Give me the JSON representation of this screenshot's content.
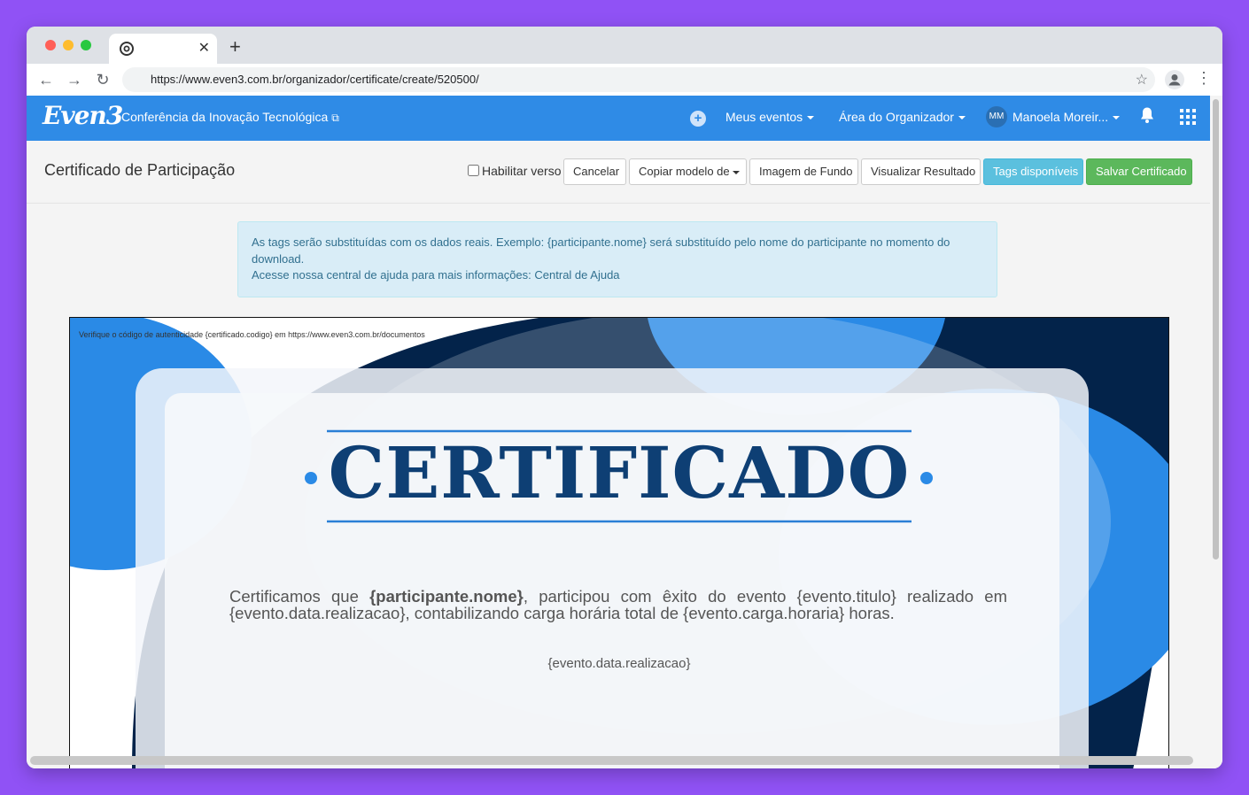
{
  "browser": {
    "url": "https://www.even3.com.br/organizador/certificate/create/520500/"
  },
  "navbar": {
    "logo": "Even3",
    "event_title": "Conferência da Inovação Tecnológica",
    "my_events": "Meus eventos",
    "organizer_area": "Área do Organizador",
    "user_initials": "MM",
    "user_name": "Manoela Moreir..."
  },
  "header": {
    "title": "Certificado de Participação",
    "enable_back_label": "Habilitar verso",
    "cancel_label": "Cancelar",
    "copy_model_label": "Copiar modelo de",
    "background_label": "Imagem de Fundo",
    "preview_label": "Visualizar Resultado",
    "tags_label": "Tags disponíveis",
    "save_label": "Salvar Certificado"
  },
  "alert": {
    "line1": "As tags serão substituídas com os dados reais. Exemplo: {participante.nome} será substituído pelo nome do participante no momento do download.",
    "line2_prefix": "Acesse nossa central de ajuda para mais informações:",
    "help_link": "Central de Ajuda"
  },
  "certificate": {
    "auth_line": "Verifique o código de autenticidade {certificado.codigo} em https://www.even3.com.br/documentos",
    "title": "CERTIFICADO",
    "body_prefix": "Certificamos que",
    "participant_tag": "{participante.nome}",
    "body_rest": ", participou com êxito do evento {evento.titulo} realizado em {evento.data.realizacao}, contabilizando carga horária total de {evento.carga.horaria} horas.",
    "date_tag": "{evento.data.realizacao}"
  },
  "colors": {
    "navbar": "#2f8be6",
    "cert_dark": "#03234a",
    "cert_blue": "#2a8ae6",
    "cert_title": "#0e3f74"
  }
}
